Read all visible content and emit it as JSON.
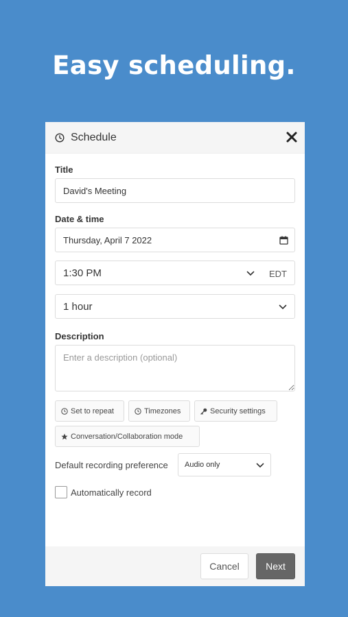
{
  "hero": {
    "headline": "Easy scheduling."
  },
  "dialog": {
    "title": "Schedule",
    "title_field": {
      "label": "Title",
      "value": "David's Meeting"
    },
    "datetime": {
      "label": "Date & time",
      "date_value": "Thursday, April 7 2022",
      "time_value": "1:30 PM",
      "timezone": "EDT",
      "duration_value": "1 hour"
    },
    "description": {
      "label": "Description",
      "placeholder": "Enter a description (optional)"
    },
    "options": {
      "repeat_label": "Set to repeat",
      "timezones_label": "Timezones",
      "security_label": "Security settings",
      "mode_label": "Conversation/Collaboration mode"
    },
    "recording": {
      "label": "Default recording preference",
      "selected": "Audio only",
      "auto_label": "Automatically record",
      "auto_checked": false
    },
    "footer": {
      "cancel_label": "Cancel",
      "next_label": "Next"
    }
  },
  "colors": {
    "background": "#4a8ccb",
    "next_button": "#666666"
  }
}
